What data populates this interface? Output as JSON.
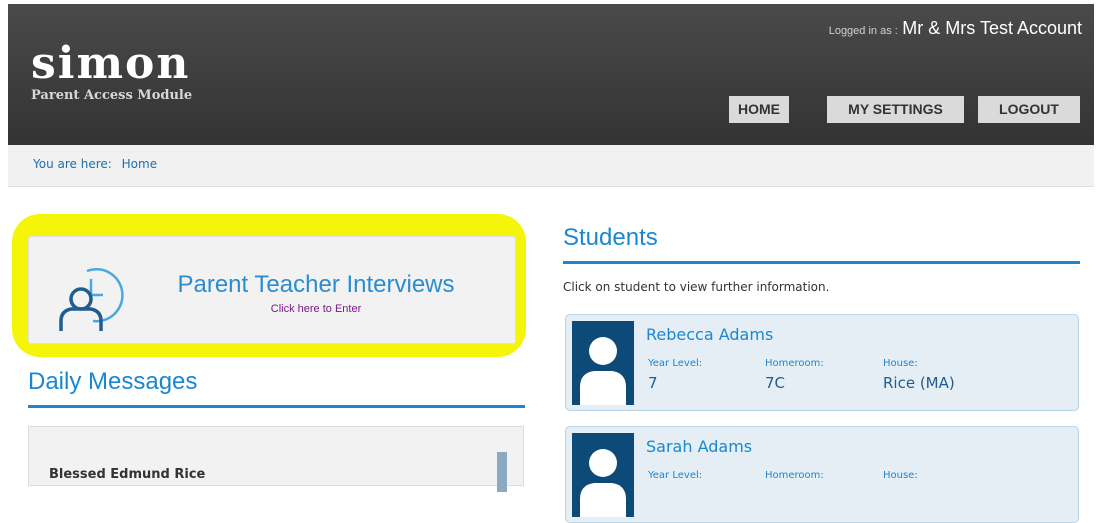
{
  "header": {
    "logo": "simon",
    "subtitle": "Parent Access Module",
    "login_prefix": "Logged in as :",
    "login_user": "Mr & Mrs Test Account",
    "nav": {
      "home": "HOME",
      "settings": "MY SETTINGS",
      "logout": "LOGOUT"
    }
  },
  "breadcrumb": {
    "label": "You are here:",
    "current": "Home"
  },
  "ptq": {
    "title": "Parent Teacher Interviews",
    "subtitle": "Click here to Enter",
    "highlight_color": "#f5f50a",
    "icon": "user-clock-icon"
  },
  "daily_messages": {
    "title": "Daily Messages",
    "first_heading": "Blessed Edmund Rice"
  },
  "students": {
    "title": "Students",
    "hint": "Click on student to view further information.",
    "field_labels": {
      "year": "Year Level:",
      "homeroom": "Homeroom:",
      "house": "House:"
    },
    "list": [
      {
        "name": "Rebecca Adams",
        "year": "7",
        "homeroom": "7C",
        "house": "Rice (MA)"
      },
      {
        "name": "Sarah Adams",
        "year": "",
        "homeroom": "",
        "house": ""
      }
    ]
  },
  "colors": {
    "accent": "#1a87d0",
    "header_bg": "#3d3d3d",
    "avatar_bg": "#0e4a78"
  }
}
